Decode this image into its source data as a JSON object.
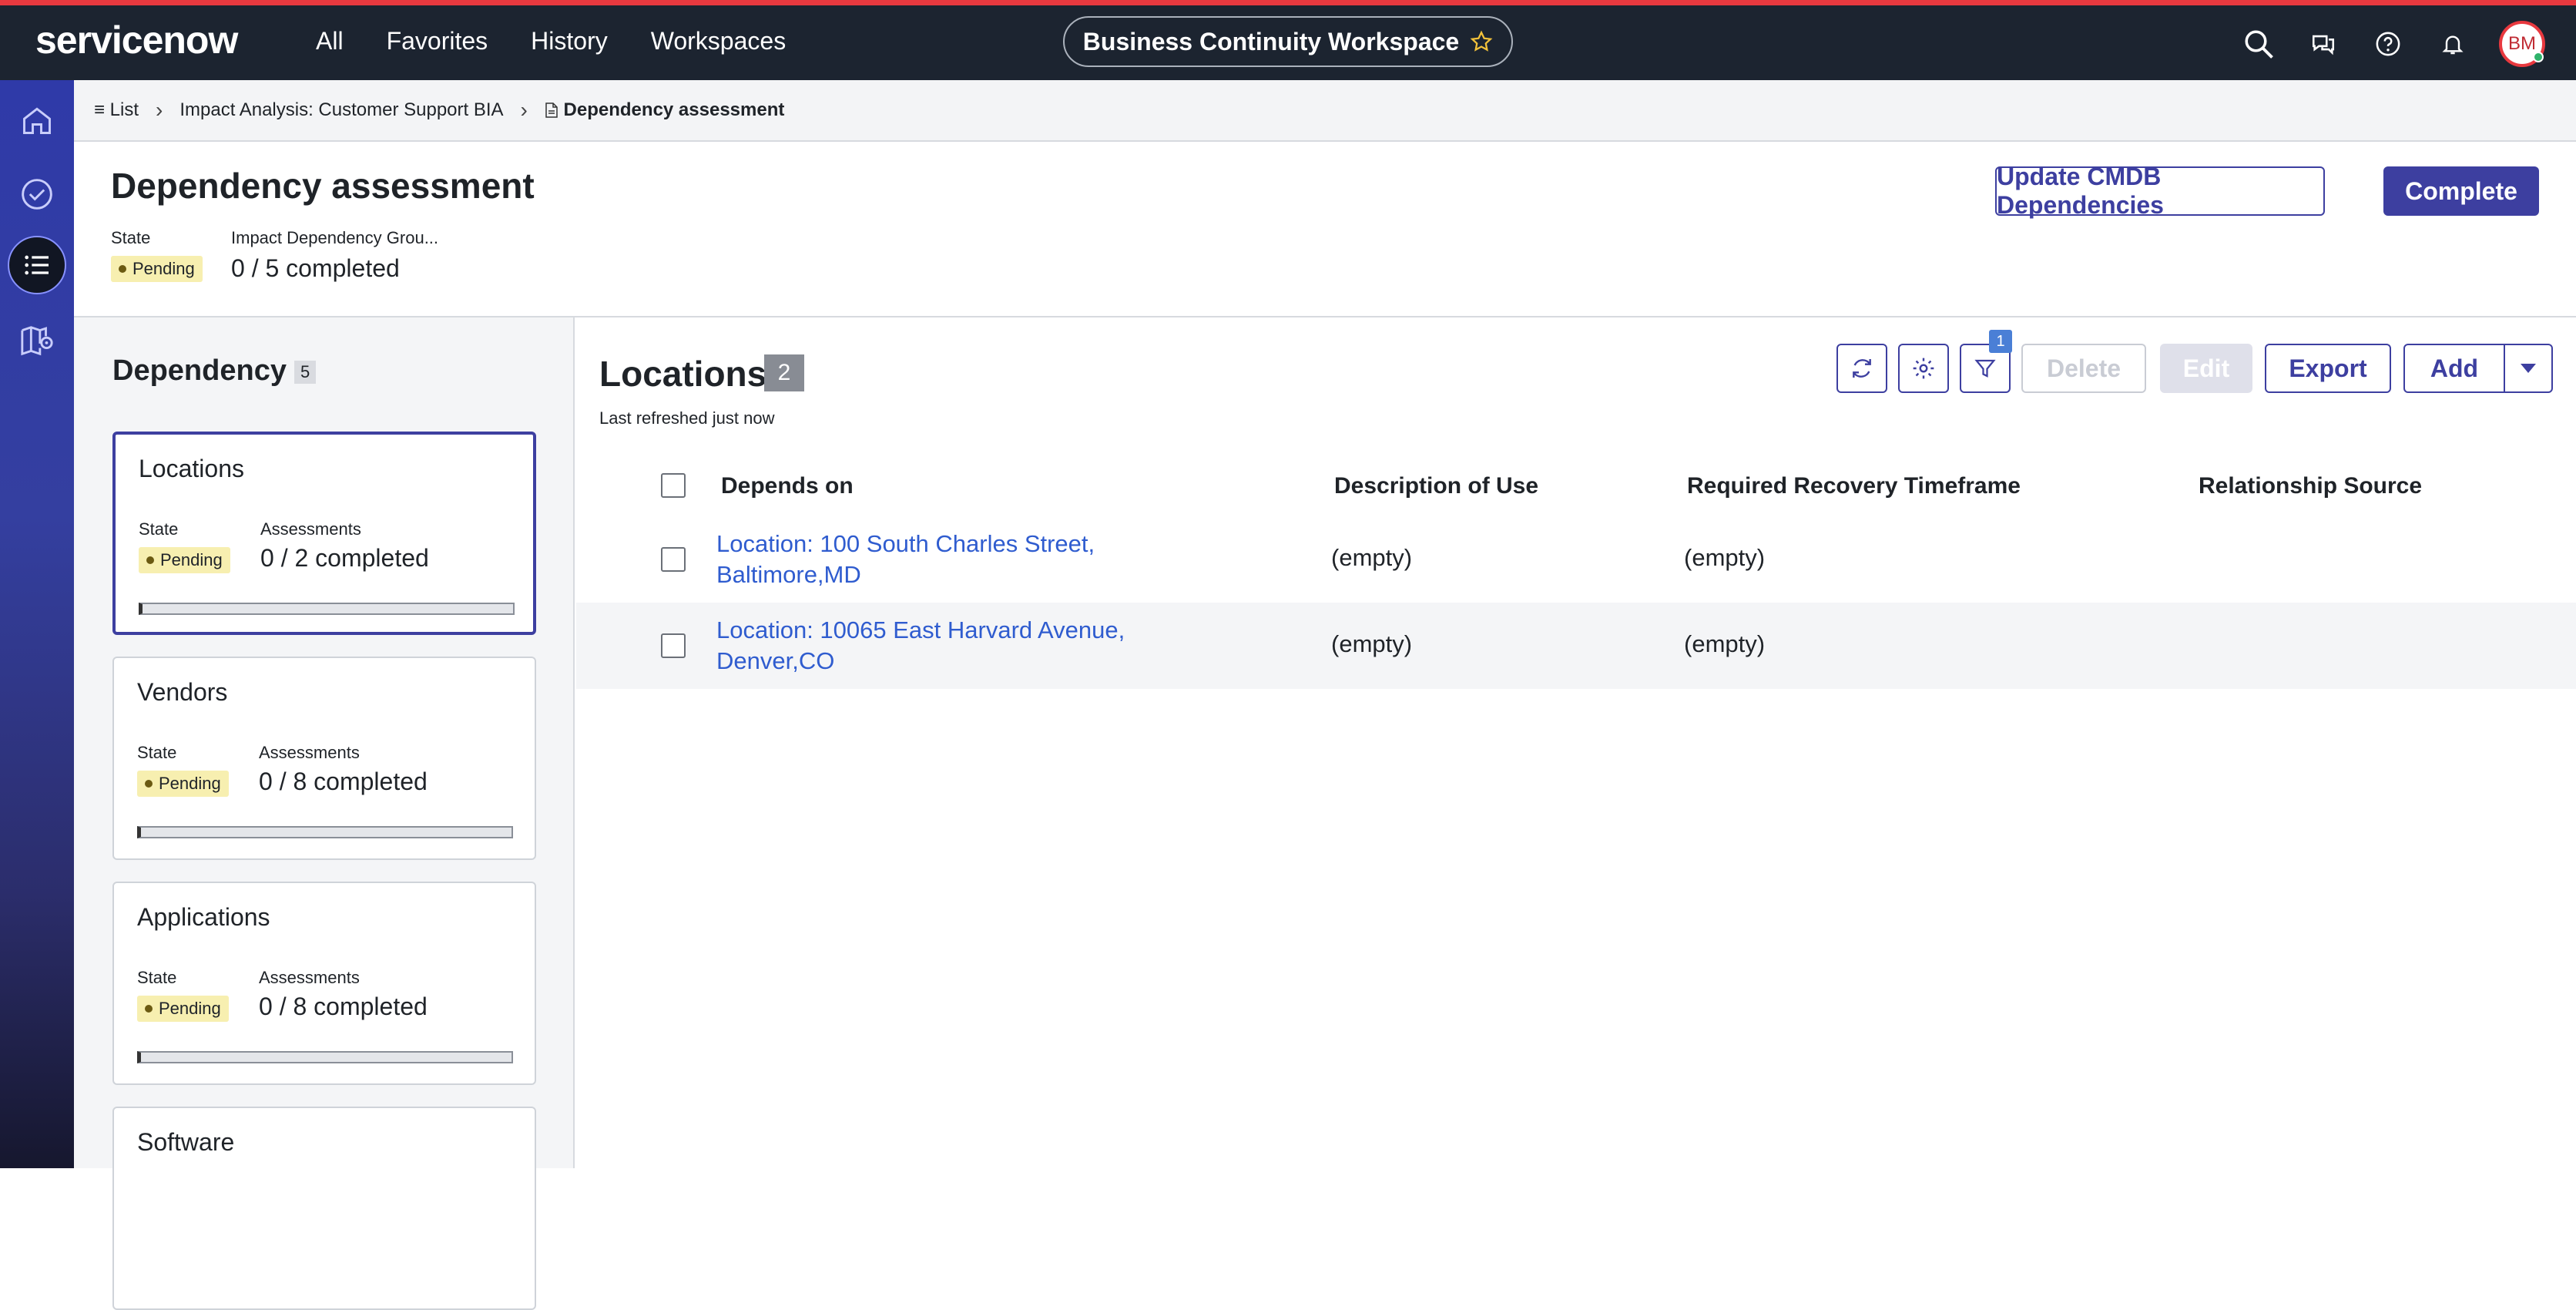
{
  "brand": {
    "logo_text": "servicenow",
    "accent": "#e8393f",
    "nav_bg": "#1c2430",
    "primary": "#3d3fa0"
  },
  "topnav": {
    "items": [
      "All",
      "Favorites",
      "History",
      "Workspaces"
    ]
  },
  "workspace": {
    "label": "Business Continuity Workspace"
  },
  "top_icons": [
    "search-icon",
    "chat-icon",
    "help-icon",
    "bell-icon"
  ],
  "user": {
    "initials": "BM"
  },
  "rail": {
    "icons": [
      "home-icon",
      "check-circle-icon",
      "list-icon",
      "map-icon"
    ]
  },
  "breadcrumb": {
    "list_label": "List",
    "parent": "Impact Analysis: Customer Support BIA",
    "current": "Dependency assessment"
  },
  "header": {
    "title": "Dependency assessment",
    "state_label": "State",
    "state_value": "Pending",
    "idg_label": "Impact Dependency Grou...",
    "idg_value": "0 / 5 completed",
    "update_button": "Update CMDB Dependencies",
    "complete_button": "Complete"
  },
  "dependency_panel": {
    "title": "Dependency",
    "count": "5",
    "cards": [
      {
        "title": "Locations",
        "state_label": "State",
        "state": "Pending",
        "assess_label": "Assessments",
        "assess": "0 / 2 completed",
        "progress": 0
      },
      {
        "title": "Vendors",
        "state_label": "State",
        "state": "Pending",
        "assess_label": "Assessments",
        "assess": "0 / 8 completed",
        "progress": 0
      },
      {
        "title": "Applications",
        "state_label": "State",
        "state": "Pending",
        "assess_label": "Assessments",
        "assess": "0 / 8 completed",
        "progress": 0
      },
      {
        "title": "Software"
      }
    ]
  },
  "list": {
    "title": "Locations",
    "count": "2",
    "subtitle": "Last refreshed just now",
    "filter_count": "1",
    "buttons": {
      "delete": "Delete",
      "edit": "Edit",
      "export": "Export",
      "add": "Add"
    },
    "columns": [
      "Depends on",
      "Description of Use",
      "Required Recovery Timeframe",
      "Relationship Source"
    ],
    "rows": [
      {
        "depends_on": "Location: 100 South Charles Street, Baltimore,MD",
        "description": "(empty)",
        "timeframe": "(empty)",
        "source": ""
      },
      {
        "depends_on": "Location: 10065 East Harvard Avenue, Denver,CO",
        "description": "(empty)",
        "timeframe": "(empty)",
        "source": ""
      }
    ]
  }
}
